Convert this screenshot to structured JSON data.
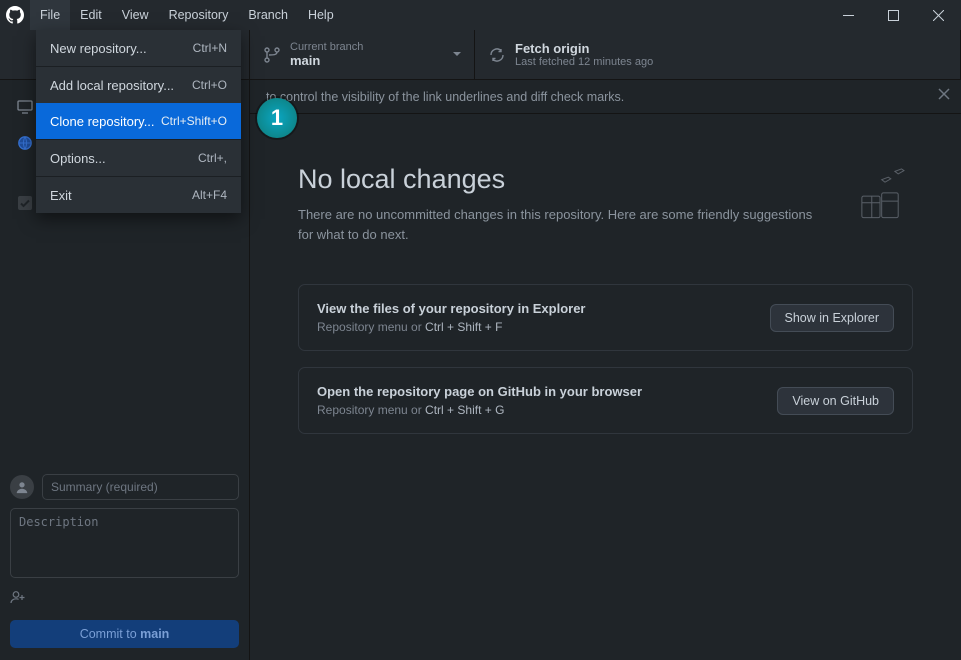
{
  "menubar": {
    "items": [
      "File",
      "Edit",
      "View",
      "Repository",
      "Branch",
      "Help"
    ]
  },
  "dropdown": {
    "items": [
      {
        "label": "New repository...",
        "shortcut": "Ctrl+N"
      },
      {
        "label": "Add local repository...",
        "shortcut": "Ctrl+O"
      },
      {
        "label": "Clone repository...",
        "shortcut": "Ctrl+Shift+O",
        "highlight": true
      },
      {
        "label": "Options...",
        "shortcut": "Ctrl+,"
      },
      {
        "label": "Exit",
        "shortcut": "Alt+F4"
      }
    ]
  },
  "toolbar": {
    "branch": {
      "label": "Current branch",
      "value": "main"
    },
    "fetch": {
      "label": "Fetch origin",
      "sub": "Last fetched 12 minutes ago"
    }
  },
  "tip": {
    "text": "to control the visibility of the link underlines and diff check marks."
  },
  "main": {
    "title": "No local changes",
    "subtitle": "There are no uncommitted changes in this repository. Here are some friendly suggestions for what to do next."
  },
  "suggestions": [
    {
      "title": "View the files of your repository in Explorer",
      "sub_prefix": "Repository menu or ",
      "keys": "Ctrl + Shift +  F",
      "button": "Show in Explorer"
    },
    {
      "title": "Open the repository page on GitHub in your browser",
      "sub_prefix": "Repository menu or ",
      "keys": "Ctrl + Shift +  G",
      "button": "View on GitHub"
    }
  ],
  "commit": {
    "summary_placeholder": "Summary (required)",
    "description_placeholder": "Description",
    "button_prefix": "Commit to ",
    "button_branch": "main"
  },
  "annotation": {
    "number": "1"
  }
}
